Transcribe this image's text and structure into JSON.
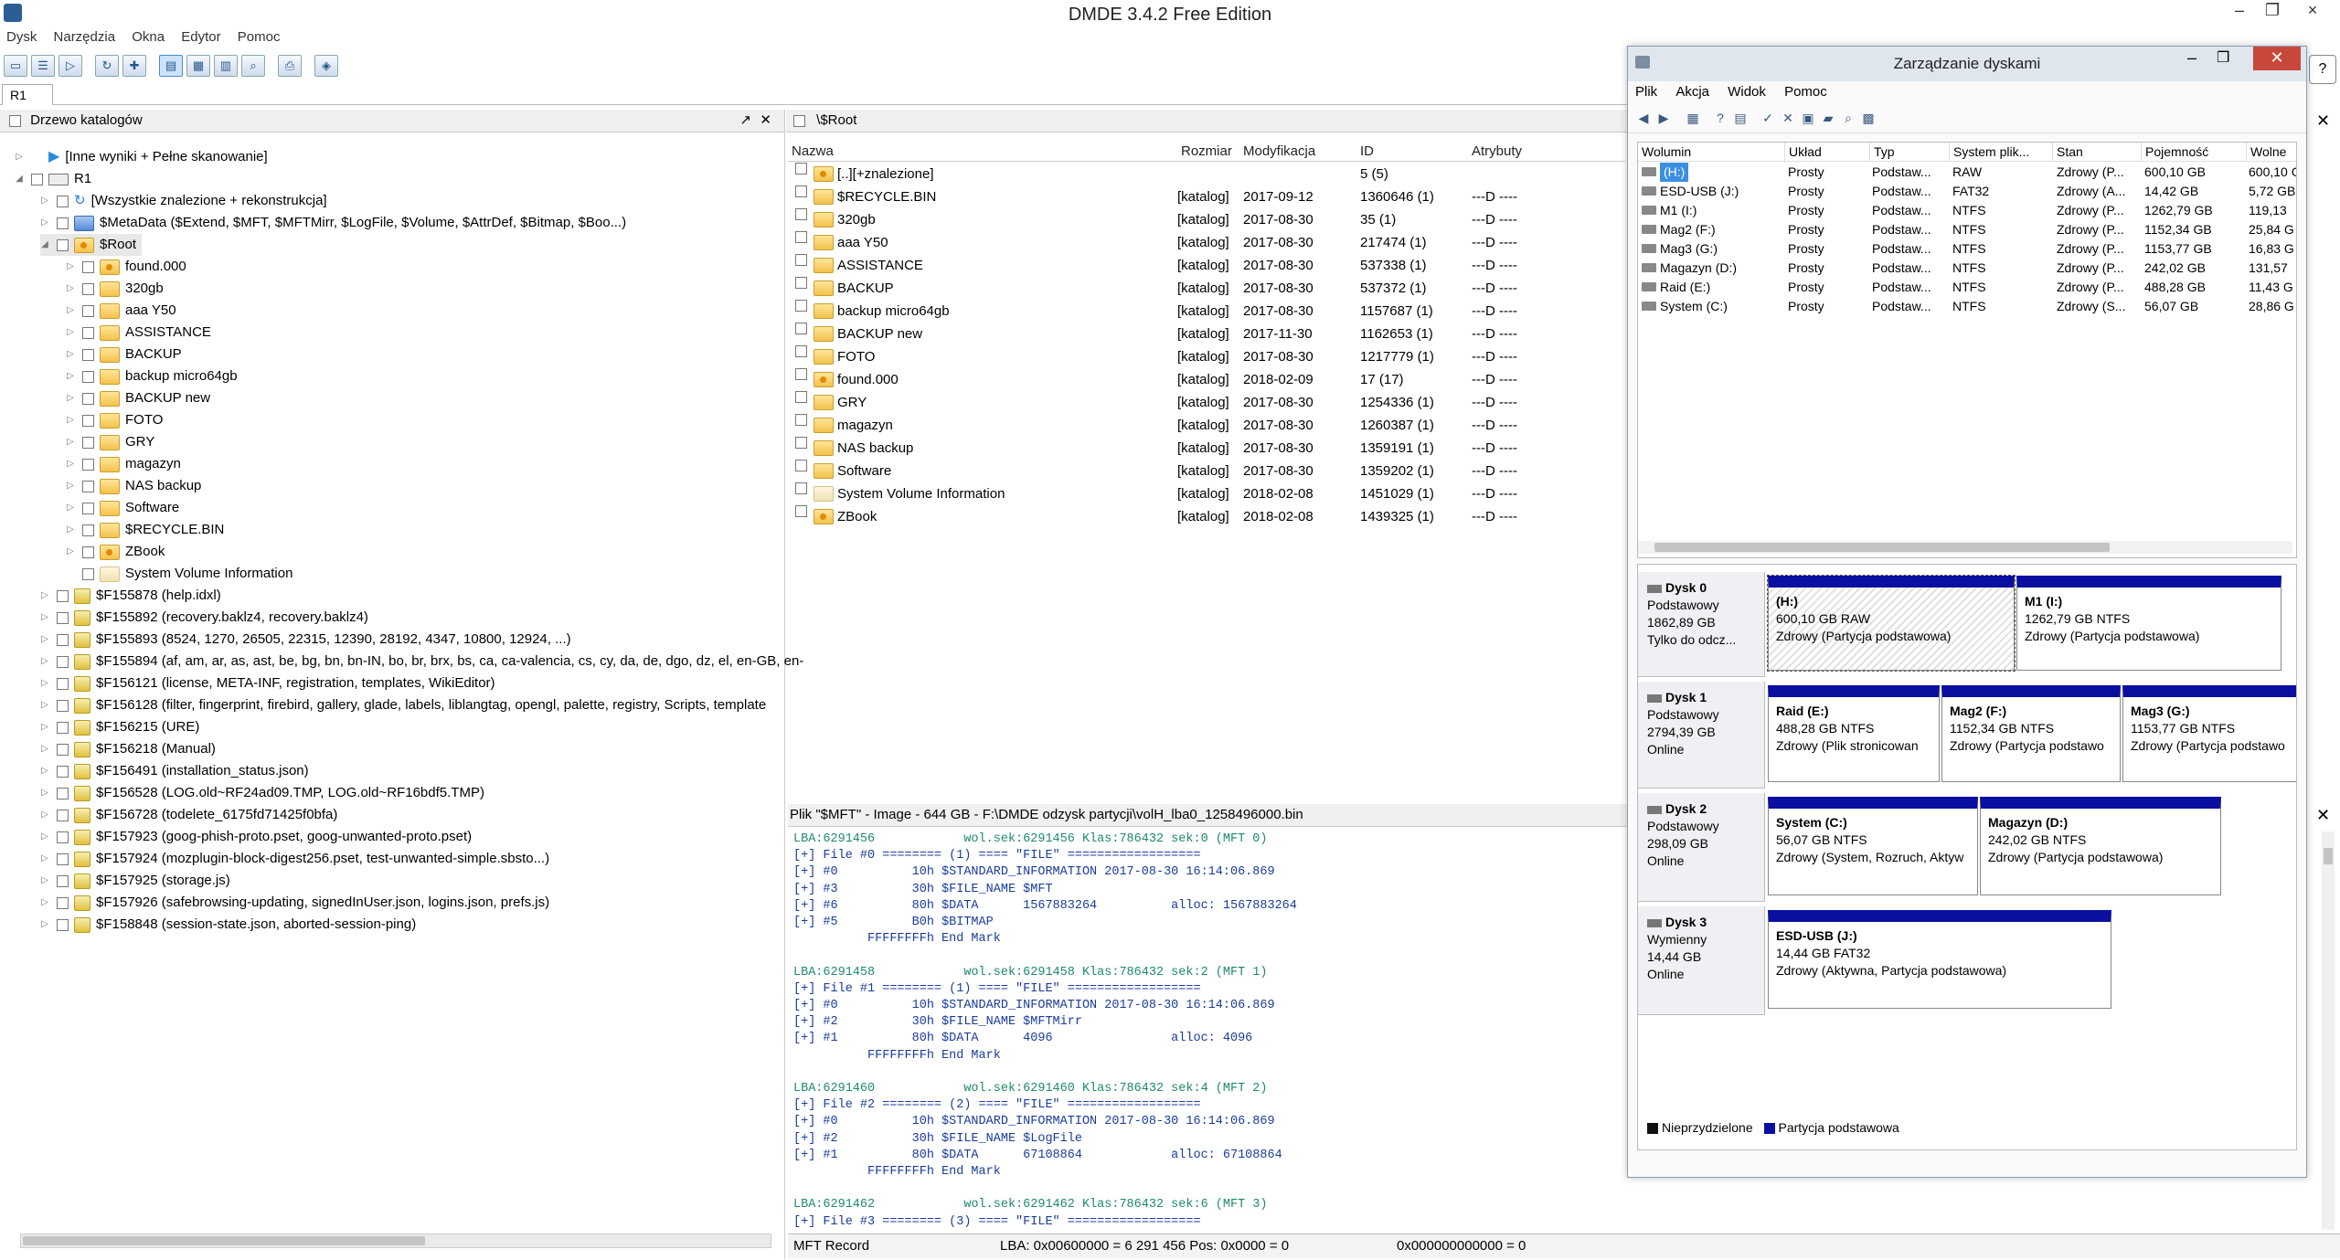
{
  "window": {
    "title": "DMDE 3.4.2 Free Edition"
  },
  "menu": [
    "Dysk",
    "Narzędzia",
    "Okna",
    "Edytor",
    "Pomoc"
  ],
  "tab": "R1",
  "tree": {
    "header": "Drzewo katalogów",
    "rows": [
      {
        "indent": 0,
        "label": "[Inne wyniki + Pełne skanowanie]",
        "icon": "play",
        "expand": "▷",
        "cb": false
      },
      {
        "indent": 0,
        "label": "R1",
        "icon": "drive",
        "expand": "◢",
        "cb": true
      },
      {
        "indent": 1,
        "label": "[Wszystkie znalezione + rekonstrukcja]",
        "icon": "refresh",
        "expand": "▷",
        "cb": true
      },
      {
        "indent": 1,
        "label": "$MetaData ($Extend, $MFT, $MFTMirr, $LogFile, $Volume, $AttrDef, $Bitmap, $Boo...)",
        "icon": "meta",
        "expand": "▷",
        "cb": true
      },
      {
        "indent": 1,
        "label": "$Root",
        "icon": "found",
        "expand": "◢",
        "cb": true,
        "selected": true
      },
      {
        "indent": 2,
        "label": "found.000",
        "icon": "found",
        "expand": "▷",
        "cb": true
      },
      {
        "indent": 2,
        "label": "320gb",
        "icon": "fold",
        "expand": "▷",
        "cb": true
      },
      {
        "indent": 2,
        "label": "aaa Y50",
        "icon": "fold",
        "expand": "▷",
        "cb": true
      },
      {
        "indent": 2,
        "label": "ASSISTANCE",
        "icon": "fold",
        "expand": "▷",
        "cb": true
      },
      {
        "indent": 2,
        "label": "BACKUP",
        "icon": "fold",
        "expand": "▷",
        "cb": true
      },
      {
        "indent": 2,
        "label": "backup micro64gb",
        "icon": "fold",
        "expand": "▷",
        "cb": true
      },
      {
        "indent": 2,
        "label": "BACKUP new",
        "icon": "fold",
        "expand": "▷",
        "cb": true
      },
      {
        "indent": 2,
        "label": "FOTO",
        "icon": "fold",
        "expand": "▷",
        "cb": true
      },
      {
        "indent": 2,
        "label": "GRY",
        "icon": "fold",
        "expand": "▷",
        "cb": true
      },
      {
        "indent": 2,
        "label": "magazyn",
        "icon": "fold",
        "expand": "▷",
        "cb": true
      },
      {
        "indent": 2,
        "label": "NAS backup",
        "icon": "fold",
        "expand": "▷",
        "cb": true
      },
      {
        "indent": 2,
        "label": "Software",
        "icon": "fold",
        "expand": "▷",
        "cb": true
      },
      {
        "indent": 2,
        "label": "$RECYCLE.BIN",
        "icon": "fold",
        "expand": "▷",
        "cb": true
      },
      {
        "indent": 2,
        "label": "ZBook",
        "icon": "found",
        "expand": "▷",
        "cb": true
      },
      {
        "indent": 2,
        "label": "System Volume Information",
        "icon": "sys",
        "expand": "",
        "cb": true
      },
      {
        "indent": 1,
        "label": "$F155878 (help.idxl)",
        "icon": "file",
        "expand": "▷",
        "cb": true
      },
      {
        "indent": 1,
        "label": "$F155892 (recovery.baklz4, recovery.baklz4)",
        "icon": "file",
        "expand": "▷",
        "cb": true
      },
      {
        "indent": 1,
        "label": "$F155893 (8524, 1270, 26505, 22315, 12390, 28192, 4347, 10800, 12924, ...)",
        "icon": "file",
        "expand": "▷",
        "cb": true
      },
      {
        "indent": 1,
        "label": "$F155894 (af, am, ar, as, ast, be, bg, bn, bn-IN, bo, br, brx, bs, ca, ca-valencia, cs, cy, da, de, dgo, dz, el, en-GB, en-",
        "icon": "file",
        "expand": "▷",
        "cb": true
      },
      {
        "indent": 1,
        "label": "$F156121 (license, META-INF, registration, templates, WikiEditor)",
        "icon": "file",
        "expand": "▷",
        "cb": true
      },
      {
        "indent": 1,
        "label": "$F156128 (filter, fingerprint, firebird, gallery, glade, labels, liblangtag, opengl, palette, registry, Scripts, template",
        "icon": "file",
        "expand": "▷",
        "cb": true
      },
      {
        "indent": 1,
        "label": "$F156215 (URE)",
        "icon": "file",
        "expand": "▷",
        "cb": true
      },
      {
        "indent": 1,
        "label": "$F156218 (Manual)",
        "icon": "file",
        "expand": "▷",
        "cb": true
      },
      {
        "indent": 1,
        "label": "$F156491 (installation_status.json)",
        "icon": "file",
        "expand": "▷",
        "cb": true
      },
      {
        "indent": 1,
        "label": "$F156528 (LOG.old~RF24ad09.TMP, LOG.old~RF16bdf5.TMP)",
        "icon": "file",
        "expand": "▷",
        "cb": true
      },
      {
        "indent": 1,
        "label": "$F156728 (todelete_6175fd71425f0bfa)",
        "icon": "file",
        "expand": "▷",
        "cb": true
      },
      {
        "indent": 1,
        "label": "$F157923 (goog-phish-proto.pset, goog-unwanted-proto.pset)",
        "icon": "file",
        "expand": "▷",
        "cb": true
      },
      {
        "indent": 1,
        "label": "$F157924 (mozplugin-block-digest256.pset, test-unwanted-simple.sbsto...)",
        "icon": "file",
        "expand": "▷",
        "cb": true
      },
      {
        "indent": 1,
        "label": "$F157925 (storage.js)",
        "icon": "file",
        "expand": "▷",
        "cb": true
      },
      {
        "indent": 1,
        "label": "$F157926 (safebrowsing-updating, signedInUser.json, logins.json, prefs.js)",
        "icon": "file",
        "expand": "▷",
        "cb": true
      },
      {
        "indent": 1,
        "label": "$F158848 (session-state.json, aborted-session-ping)",
        "icon": "file",
        "expand": "▷",
        "cb": true
      }
    ]
  },
  "list": {
    "path": "\\$Root",
    "columns": [
      "Nazwa",
      "Rozmiar",
      "Modyfikacja",
      "ID",
      "Atrybuty"
    ],
    "rows": [
      {
        "icon": "found",
        "name": "[..][+znalezione]",
        "size": "",
        "date": "",
        "id": "5 (5)",
        "attr": ""
      },
      {
        "icon": "fold",
        "name": "$RECYCLE.BIN",
        "size": "[katalog]",
        "date": "2017-09-12",
        "id": "1360646 (1)",
        "attr": "---D ----"
      },
      {
        "icon": "fold",
        "name": "320gb",
        "size": "[katalog]",
        "date": "2017-08-30",
        "id": "35 (1)",
        "attr": "---D ----"
      },
      {
        "icon": "fold",
        "name": "aaa Y50",
        "size": "[katalog]",
        "date": "2017-08-30",
        "id": "217474 (1)",
        "attr": "---D ----"
      },
      {
        "icon": "fold",
        "name": "ASSISTANCE",
        "size": "[katalog]",
        "date": "2017-08-30",
        "id": "537338 (1)",
        "attr": "---D ----"
      },
      {
        "icon": "fold",
        "name": "BACKUP",
        "size": "[katalog]",
        "date": "2017-08-30",
        "id": "537372 (1)",
        "attr": "---D ----"
      },
      {
        "icon": "fold",
        "name": "backup micro64gb",
        "size": "[katalog]",
        "date": "2017-08-30",
        "id": "1157687 (1)",
        "attr": "---D ----"
      },
      {
        "icon": "fold",
        "name": "BACKUP new",
        "size": "[katalog]",
        "date": "2017-11-30",
        "id": "1162653 (1)",
        "attr": "---D ----"
      },
      {
        "icon": "fold",
        "name": "FOTO",
        "size": "[katalog]",
        "date": "2017-08-30",
        "id": "1217779 (1)",
        "attr": "---D ----"
      },
      {
        "icon": "found",
        "name": "found.000",
        "size": "[katalog]",
        "date": "2018-02-09",
        "id": "17 (17)",
        "attr": "---D ----"
      },
      {
        "icon": "fold",
        "name": "GRY",
        "size": "[katalog]",
        "date": "2017-08-30",
        "id": "1254336 (1)",
        "attr": "---D ----"
      },
      {
        "icon": "fold",
        "name": "magazyn",
        "size": "[katalog]",
        "date": "2017-08-30",
        "id": "1260387 (1)",
        "attr": "---D ----"
      },
      {
        "icon": "fold",
        "name": "NAS backup",
        "size": "[katalog]",
        "date": "2017-08-30",
        "id": "1359191 (1)",
        "attr": "---D ----"
      },
      {
        "icon": "fold",
        "name": "Software",
        "size": "[katalog]",
        "date": "2017-08-30",
        "id": "1359202 (1)",
        "attr": "---D ----"
      },
      {
        "icon": "sys",
        "name": "System Volume Information",
        "size": "[katalog]",
        "date": "2018-02-08",
        "id": "1451029 (1)",
        "attr": "---D ----"
      },
      {
        "icon": "found",
        "name": "ZBook",
        "size": "[katalog]",
        "date": "2018-02-08",
        "id": "1439325 (1)",
        "attr": "---D ----"
      }
    ]
  },
  "hex": {
    "header": "Plik \"$MFT\" - Image - 644 GB - F:\\DMDE odzysk partycji\\volH_lba0_1258496000.bin",
    "lines": [
      {
        "c": "green",
        "t": "LBA:6291456            wol.sek:6291456 Klas:786432 sek:0 (MFT 0)"
      },
      {
        "c": "blue",
        "t": "[+] File #0 ======== (1) ==== \"FILE\" =================="
      },
      {
        "c": "blue",
        "t": "[+] #0          10h $STANDARD_INFORMATION 2017-08-30 16:14:06.869"
      },
      {
        "c": "blue",
        "t": "[+] #3          30h $FILE_NAME $MFT"
      },
      {
        "c": "blue",
        "t": "[+] #6          80h $DATA      1567883264          alloc: 1567883264"
      },
      {
        "c": "blue",
        "t": "[+] #5          B0h $BITMAP"
      },
      {
        "c": "blue",
        "t": "          FFFFFFFFh End Mark"
      },
      {
        "c": "",
        "t": ""
      },
      {
        "c": "green",
        "t": "LBA:6291458            wol.sek:6291458 Klas:786432 sek:2 (MFT 1)"
      },
      {
        "c": "blue",
        "t": "[+] File #1 ======== (1) ==== \"FILE\" =================="
      },
      {
        "c": "blue",
        "t": "[+] #0          10h $STANDARD_INFORMATION 2017-08-30 16:14:06.869"
      },
      {
        "c": "blue",
        "t": "[+] #2          30h $FILE_NAME $MFTMirr"
      },
      {
        "c": "blue",
        "t": "[+] #1          80h $DATA      4096                alloc: 4096"
      },
      {
        "c": "blue",
        "t": "          FFFFFFFFh End Mark"
      },
      {
        "c": "",
        "t": ""
      },
      {
        "c": "green",
        "t": "LBA:6291460            wol.sek:6291460 Klas:786432 sek:4 (MFT 2)"
      },
      {
        "c": "blue",
        "t": "[+] File #2 ======== (2) ==== \"FILE\" =================="
      },
      {
        "c": "blue",
        "t": "[+] #0          10h $STANDARD_INFORMATION 2017-08-30 16:14:06.869"
      },
      {
        "c": "blue",
        "t": "[+] #2          30h $FILE_NAME $LogFile"
      },
      {
        "c": "blue",
        "t": "[+] #1          80h $DATA      67108864            alloc: 67108864"
      },
      {
        "c": "blue",
        "t": "          FFFFFFFFh End Mark"
      },
      {
        "c": "",
        "t": ""
      },
      {
        "c": "green",
        "t": "LBA:6291462            wol.sek:6291462 Klas:786432 sek:6 (MFT 3)"
      },
      {
        "c": "blue",
        "t": "[+] File #3 ======== (3) ==== \"FILE\" =================="
      }
    ]
  },
  "status": {
    "left": "MFT Record",
    "mid": "LBA: 0x00600000 = 6 291 456   Pos: 0x0000 = 0",
    "right": "0x000000000000 = 0"
  },
  "dm": {
    "title": "Zarządzanie dyskami",
    "menu": [
      "Plik",
      "Akcja",
      "Widok",
      "Pomoc"
    ],
    "columns": [
      "Wolumin",
      "Układ",
      "Typ",
      "System plik...",
      "Stan",
      "Pojemność",
      "Wolne"
    ],
    "volumes": [
      {
        "name": "(H:)",
        "layout": "Prosty",
        "type": "Podstaw...",
        "fs": "RAW",
        "state": "Zdrowy (P...",
        "cap": "600,10 GB",
        "free": "600,10 G",
        "sel": true
      },
      {
        "name": "ESD-USB (J:)",
        "layout": "Prosty",
        "type": "Podstaw...",
        "fs": "FAT32",
        "state": "Zdrowy (A...",
        "cap": "14,42 GB",
        "free": "5,72 GB"
      },
      {
        "name": "M1 (I:)",
        "layout": "Prosty",
        "type": "Podstaw...",
        "fs": "NTFS",
        "state": "Zdrowy (P...",
        "cap": "1262,79 GB",
        "free": "119,13"
      },
      {
        "name": "Mag2 (F:)",
        "layout": "Prosty",
        "type": "Podstaw...",
        "fs": "NTFS",
        "state": "Zdrowy (P...",
        "cap": "1152,34 GB",
        "free": "25,84 G"
      },
      {
        "name": "Mag3 (G:)",
        "layout": "Prosty",
        "type": "Podstaw...",
        "fs": "NTFS",
        "state": "Zdrowy (P...",
        "cap": "1153,77 GB",
        "free": "16,83 G"
      },
      {
        "name": "Magazyn (D:)",
        "layout": "Prosty",
        "type": "Podstaw...",
        "fs": "NTFS",
        "state": "Zdrowy (P...",
        "cap": "242,02 GB",
        "free": "131,57"
      },
      {
        "name": "Raid (E:)",
        "layout": "Prosty",
        "type": "Podstaw...",
        "fs": "NTFS",
        "state": "Zdrowy (P...",
        "cap": "488,28 GB",
        "free": "11,43 G"
      },
      {
        "name": "System (C:)",
        "layout": "Prosty",
        "type": "Podstaw...",
        "fs": "NTFS",
        "state": "Zdrowy (S...",
        "cap": "56,07 GB",
        "free": "28,86 G"
      }
    ],
    "disks": [
      {
        "name": "Dysk 0",
        "kind": "Podstawowy",
        "size": "1862,89 GB",
        "status": "Tylko do odcz...",
        "parts": [
          {
            "title": "(H:)",
            "l2": "600,10 GB RAW",
            "l3": "Zdrowy (Partycja podstawowa)",
            "w": 270,
            "hatch": true
          },
          {
            "title": "M1  (I:)",
            "l2": "1262,79 GB NTFS",
            "l3": "Zdrowy (Partycja podstawowa)",
            "w": 290
          }
        ]
      },
      {
        "name": "Dysk 1",
        "kind": "Podstawowy",
        "size": "2794,39 GB",
        "status": "Online",
        "parts": [
          {
            "title": "Raid  (E:)",
            "l2": "488,28 GB NTFS",
            "l3": "Zdrowy (Plik stronicowan",
            "w": 188
          },
          {
            "title": "Mag2  (F:)",
            "l2": "1152,34 GB NTFS",
            "l3": "Zdrowy (Partycja podstawo",
            "w": 196
          },
          {
            "title": "Mag3  (G:)",
            "l2": "1153,77 GB NTFS",
            "l3": "Zdrowy (Partycja podstawo",
            "w": 196
          }
        ]
      },
      {
        "name": "Dysk 2",
        "kind": "Podstawowy",
        "size": "298,09 GB",
        "status": "Online",
        "parts": [
          {
            "title": "System  (C:)",
            "l2": "56,07 GB NTFS",
            "l3": "Zdrowy (System, Rozruch, Aktyw",
            "w": 230
          },
          {
            "title": "Magazyn  (D:)",
            "l2": "242,02 GB NTFS",
            "l3": "Zdrowy (Partycja podstawowa)",
            "w": 264
          }
        ]
      },
      {
        "name": "Dysk 3",
        "kind": "Wymienny",
        "size": "14,44 GB",
        "status": "Online",
        "parts": [
          {
            "title": "ESD-USB  (J:)",
            "l2": "14,44 GB FAT32",
            "l3": "Zdrowy (Aktywna, Partycja podstawowa)",
            "w": 376
          }
        ]
      }
    ],
    "legend": [
      "Nieprzydzielone",
      "Partycja podstawowa"
    ]
  }
}
